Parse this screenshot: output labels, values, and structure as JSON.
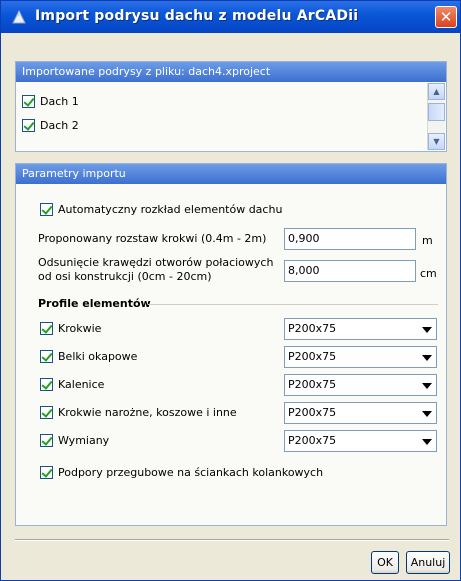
{
  "window": {
    "title": "Import podrysu dachu z modelu ArCADii",
    "close_glyph": "✕"
  },
  "import_panel": {
    "header": "Importowane podrysy z pliku: dach4.xproject",
    "items": [
      {
        "label": "Dach 1",
        "checked": true
      },
      {
        "label": "Dach 2",
        "checked": true
      }
    ]
  },
  "params_panel": {
    "header": "Parametry importu",
    "auto_layout_label": "Automatyczny rozkład elementów dachu",
    "spacing_label": "Proponowany rozstaw krokwi (0.4m - 2m)",
    "spacing_value": "0,900",
    "spacing_unit": "m",
    "offset_label_line1": "Odsunięcie krawędzi otworów połaciowych",
    "offset_label_line2": "od osi konstrukcji (0cm - 20cm)",
    "offset_value": "8,000",
    "offset_unit": "cm",
    "profiles_title": "Profile elementów",
    "profiles": [
      {
        "label": "Krokwie",
        "value": "P200x75",
        "checked": true
      },
      {
        "label": "Belki okapowe",
        "value": "P200x75",
        "checked": true
      },
      {
        "label": "Kalenice",
        "value": "P200x75",
        "checked": true
      },
      {
        "label": "Krokwie narożne, koszowe i inne",
        "value": "P200x75",
        "checked": true
      },
      {
        "label": "Wymiany",
        "value": "P200x75",
        "checked": true
      }
    ],
    "hinge_label": "Podpory przegubowe na ściankach kolankowych"
  },
  "buttons": {
    "ok": "OK",
    "cancel": "Anuluj"
  },
  "icons": {
    "app": "arcadia-app-icon",
    "scroll_up": "scroll-up-arrow-icon",
    "scroll_down": "scroll-down-arrow-icon",
    "combo_arrow": "chevron-down-icon"
  },
  "colors": {
    "titlebar": "#0a58d8",
    "panel_header": "#3d6fd0",
    "close": "#d9431c",
    "check": "#21a121"
  }
}
